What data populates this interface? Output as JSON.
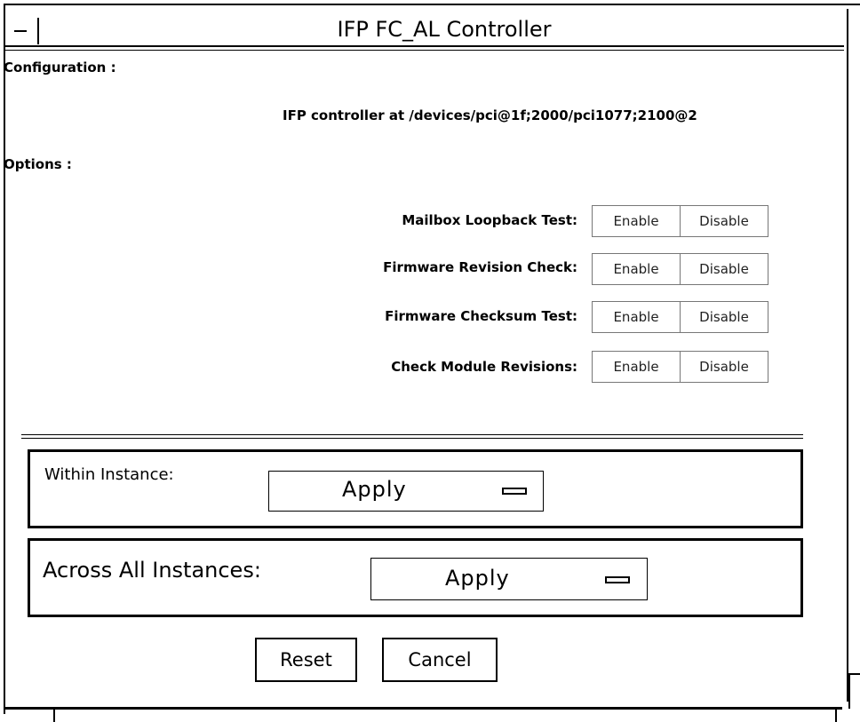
{
  "window": {
    "title": "IFP FC_AL Controller"
  },
  "configuration": {
    "label": "Configuration :",
    "controller_path": "IFP controller at /devices/pci@1f;2000/pci1077;2100@2"
  },
  "options": {
    "label": "Options :",
    "items": [
      {
        "label": "Mailbox Loopback Test:",
        "enable": "Enable",
        "disable": "Disable"
      },
      {
        "label": "Firmware Revision Check:",
        "enable": "Enable",
        "disable": "Disable"
      },
      {
        "label": "Firmware Checksum Test:",
        "enable": "Enable",
        "disable": "Disable"
      },
      {
        "label": "Check Module Revisions:",
        "enable": "Enable",
        "disable": "Disable"
      }
    ]
  },
  "within_instance": {
    "label": "Within Instance:",
    "value": "Apply"
  },
  "across_instances": {
    "label": "Across All Instances:",
    "value": "Apply"
  },
  "actions": {
    "reset": "Reset",
    "cancel": "Cancel"
  }
}
